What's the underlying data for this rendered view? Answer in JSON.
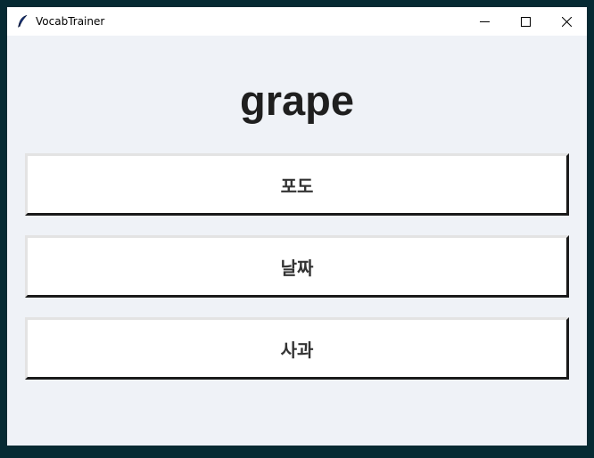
{
  "window": {
    "title": "VocabTrainer",
    "app_icon": "feather-icon",
    "controls": [
      "minimize-icon",
      "maximize-icon",
      "close-icon"
    ]
  },
  "quiz": {
    "word": "grape",
    "choices": [
      "포도",
      "날짜",
      "사과"
    ]
  },
  "colors": {
    "background": "#eff2f7",
    "button_bg": "#ffffff",
    "text": "#1f1f1f"
  }
}
